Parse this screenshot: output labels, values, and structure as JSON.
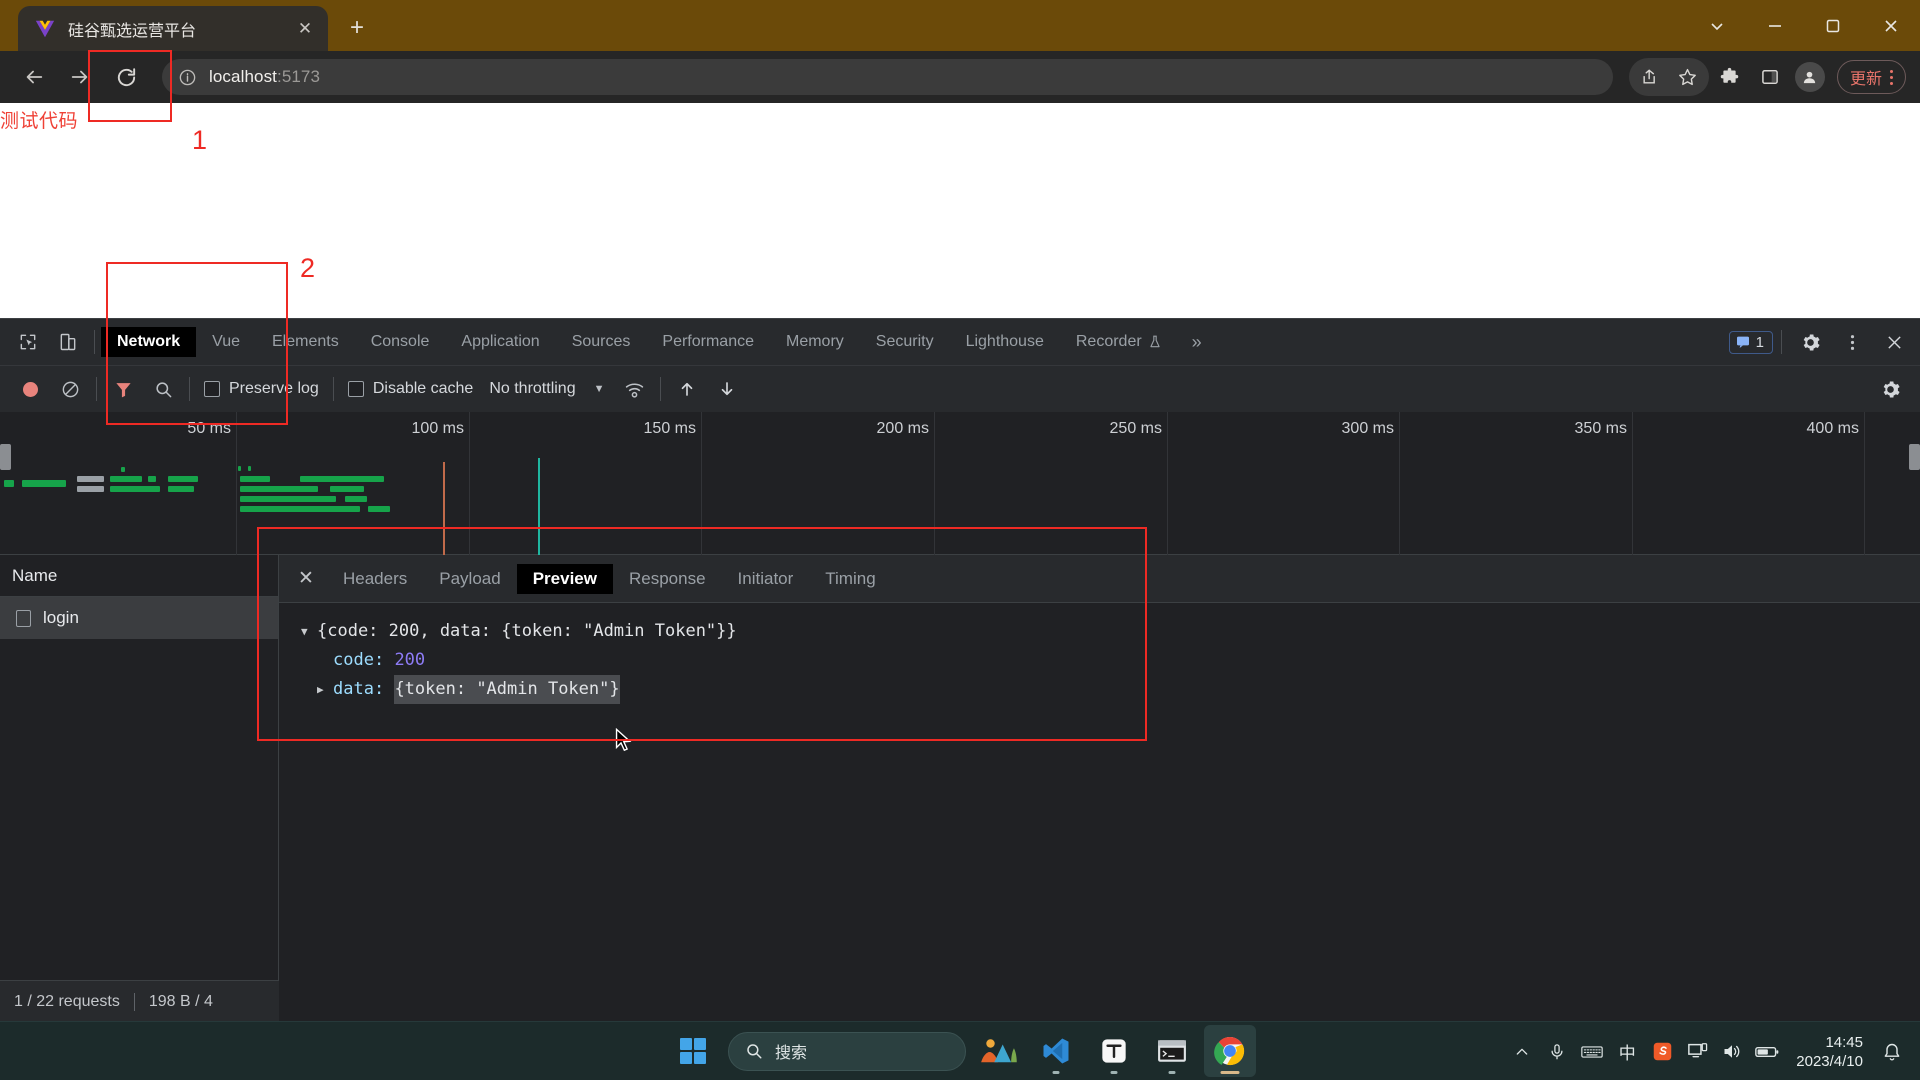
{
  "browser": {
    "tab": {
      "title": "硅谷甄选运营平台",
      "favicon": "vue-logo-icon",
      "close_label": "✕"
    },
    "newtab_label": "+",
    "window_controls": {
      "minimize": "—",
      "maximize": "▢",
      "close": "✕",
      "expand": "⌄"
    },
    "toolbar": {
      "back": "←",
      "forward": "→",
      "reload": "⟳",
      "url_host": "localhost",
      "url_port": ":5173",
      "update_button": "更新"
    }
  },
  "page": {
    "test_text": "测试代码"
  },
  "devtools": {
    "tabs": [
      {
        "label": "Network",
        "active": true
      },
      {
        "label": "Vue",
        "active": false
      },
      {
        "label": "Elements",
        "active": false
      },
      {
        "label": "Console",
        "active": false
      },
      {
        "label": "Application",
        "active": false
      },
      {
        "label": "Sources",
        "active": false
      },
      {
        "label": "Performance",
        "active": false
      },
      {
        "label": "Memory",
        "active": false
      },
      {
        "label": "Security",
        "active": false
      },
      {
        "label": "Lighthouse",
        "active": false
      },
      {
        "label": "Recorder",
        "active": false
      }
    ],
    "more_tabs": "»",
    "message_count": "1",
    "toolbar": {
      "preserve_log": "Preserve log",
      "disable_cache": "Disable cache",
      "throttling": "No throttling",
      "throttling_caret": "▼"
    },
    "timeline": {
      "ticks": [
        "50 ms",
        "100 ms",
        "150 ms",
        "200 ms",
        "250 ms",
        "300 ms",
        "350 ms",
        "400 ms"
      ]
    },
    "requests": {
      "column_header": "Name",
      "rows": [
        {
          "name": "login",
          "selected": true
        }
      ]
    },
    "status_bar": {
      "requests": "1 / 22 requests",
      "transferred": "198 B / 4"
    },
    "detail_tabs": [
      {
        "label": "Headers",
        "active": false
      },
      {
        "label": "Payload",
        "active": false
      },
      {
        "label": "Preview",
        "active": true
      },
      {
        "label": "Response",
        "active": false
      },
      {
        "label": "Initiator",
        "active": false
      },
      {
        "label": "Timing",
        "active": false
      }
    ],
    "detail_close": "✕",
    "preview_json": {
      "root_triangle": "▼",
      "root_summary": "{code: 200, data: {token: \"Admin Token\"}}",
      "code_key": "code:",
      "code_value": "200",
      "data_triangle": "▶",
      "data_key": "data:",
      "data_value": "{token: \"Admin Token\"}"
    }
  },
  "annotations": [
    {
      "id": "1",
      "label": "1"
    },
    {
      "id": "2",
      "label": "2"
    }
  ],
  "taskbar": {
    "search_placeholder": "搜索",
    "apps": [
      "widgets-icon",
      "vscode-icon",
      "typora-icon",
      "terminal-icon",
      "chrome-icon"
    ],
    "tray": {
      "chevron": "⌃",
      "ime": "中",
      "time": "14:45",
      "date": "2023/4/10"
    }
  },
  "colors": {
    "accent_red": "#ee2a24",
    "tabstrip": "#6b4a09",
    "devtools_bg": "#202124",
    "taskbar": "#1c2b2b",
    "json_number": "#8d7bf5",
    "json_key": "#9cdcfe"
  }
}
